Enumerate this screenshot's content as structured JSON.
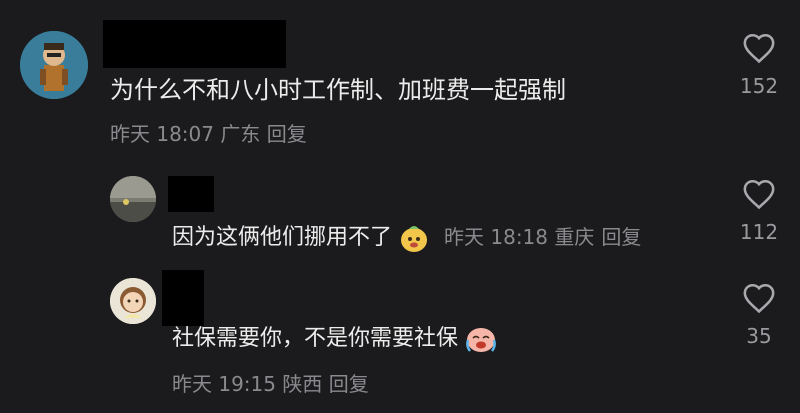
{
  "comments": [
    {
      "text": "为什么不和八小时工作制、加班费一起强制",
      "meta": "昨天 18:07 广东",
      "reply": "回复",
      "likes": "152"
    },
    {
      "text": "因为这俩他们挪用不了",
      "meta": "昨天 18:18 重庆",
      "reply": "回复",
      "likes": "112"
    },
    {
      "text": "社保需要你，不是你需要社保",
      "meta": "昨天 19:15 陕西",
      "reply": "回复",
      "likes": "35"
    }
  ]
}
